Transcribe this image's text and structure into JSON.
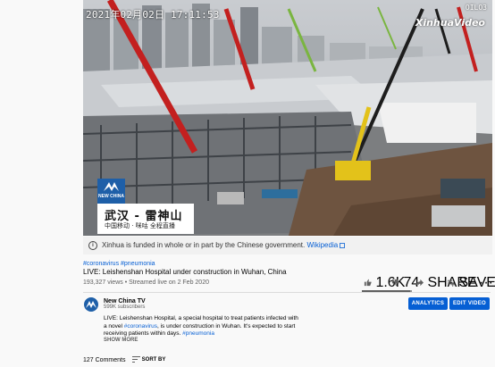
{
  "video": {
    "timestamp": "2021年02月02日 17:11:53",
    "watermark": "XinhuaVideo",
    "watermark_code": "OILO3",
    "brand_box_text": "NEW CHINA",
    "caption_main": "武汉 - 雷神山",
    "caption_sub": "中国移动 · 咪咕 全程直播"
  },
  "info_bar": {
    "icon": "info-icon",
    "text": "Xinhua is funded in whole or in part by the Chinese government.",
    "link": "Wikipedia"
  },
  "hashtags": "#coronavirus #pneumonia",
  "title": "LIVE: Leishenshan Hospital under construction in Wuhan, China",
  "meta": "193,327 views • Streamed live on 2 Feb 2020",
  "actions": {
    "likes": "1.6K",
    "dislikes": "74",
    "share": "SHARE",
    "save": "SAVE",
    "more": "···"
  },
  "like_ratio": 0.956,
  "channel": {
    "name": "New China TV",
    "subscribers": "599K subscribers"
  },
  "buttons": {
    "analytics": "ANALYTICS",
    "edit": "EDIT VIDEO"
  },
  "description": {
    "line1": "LIVE: Leishenshan Hospital, a special hospital to treat patients infected with",
    "line2_pre": "a novel ",
    "line2_tag": "#coronavirus",
    "line2_post": ", is under construction in Wuhan. It's expected to start",
    "line3_pre": "receiving patients within days. ",
    "line3_tag": "#pneumonia",
    "show_more": "SHOW MORE"
  },
  "comments": {
    "count": "127 Comments",
    "sort": "SORT BY"
  },
  "colors": {
    "link_blue": "#065fd4",
    "button_blue": "#065fd4",
    "xinhua_blue": "#1e5fa8",
    "page_bg": "#f9f9f9"
  }
}
